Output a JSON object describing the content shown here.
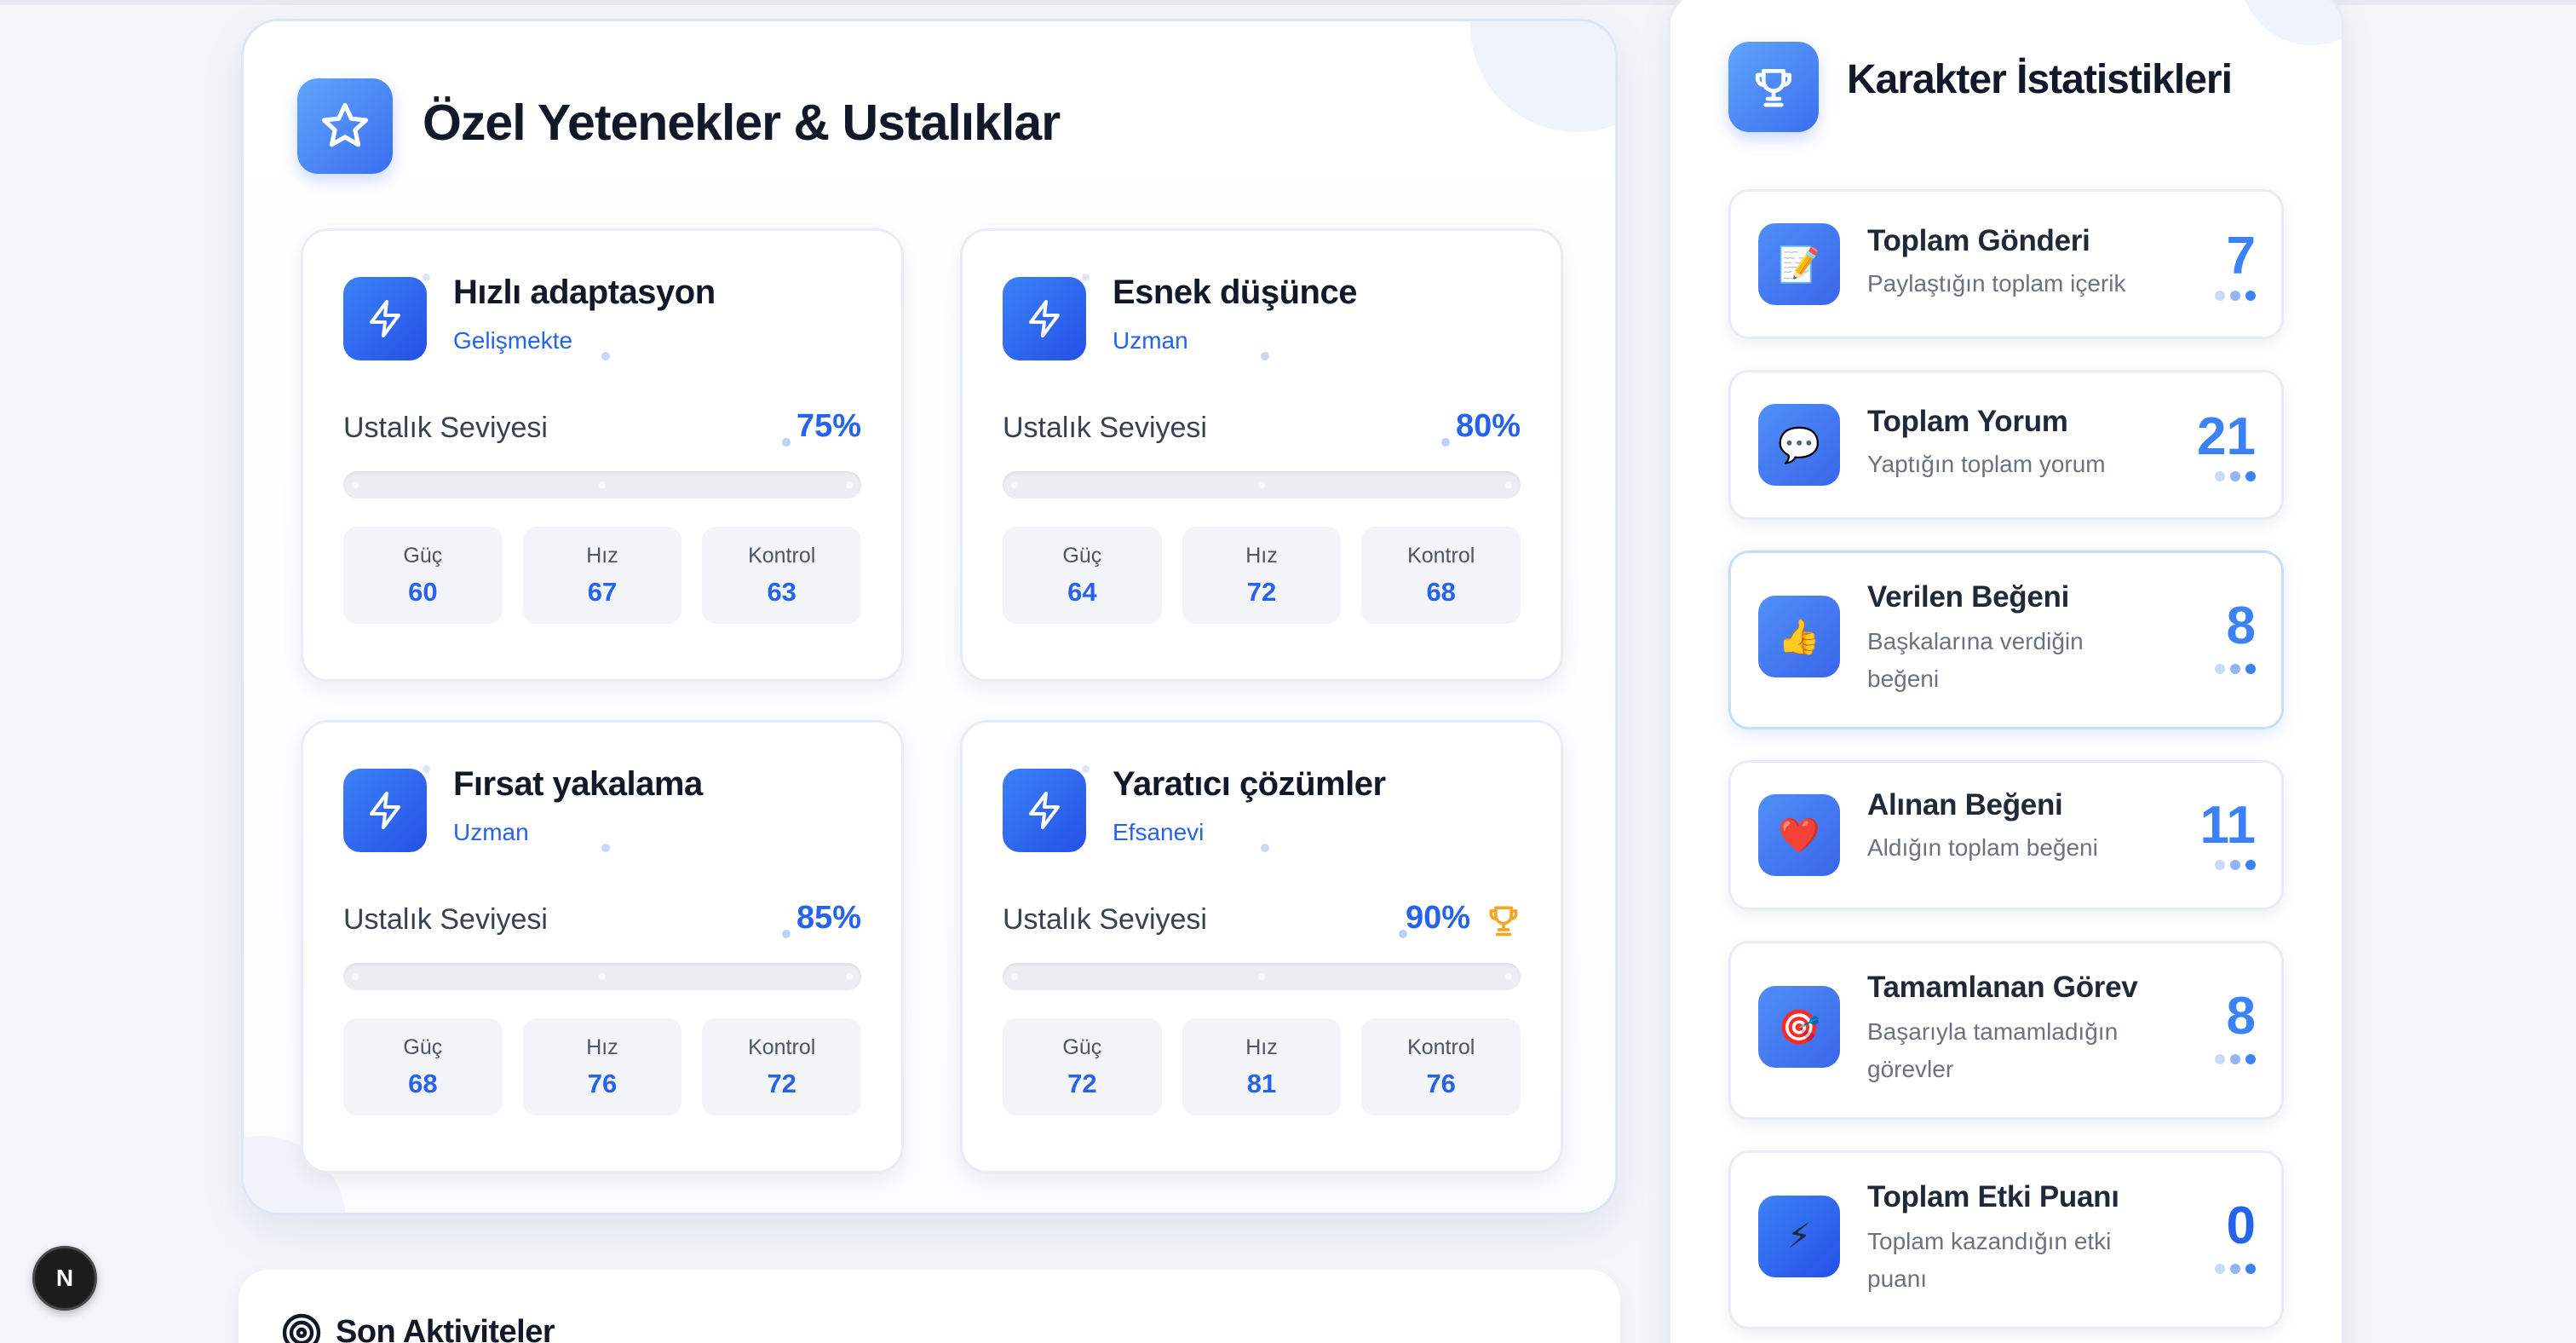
{
  "skills_panel": {
    "title": "Özel Yetenekler & Ustalıklar",
    "mastery_label": "Ustalık Seviyesi",
    "stat_labels": {
      "power": "Güç",
      "speed": "Hız",
      "control": "Kontrol"
    },
    "skills": [
      {
        "name": "Hızlı adaptasyon",
        "level": "Gelişmekte",
        "mastery": "75%",
        "power": "60",
        "speed": "67",
        "control": "63"
      },
      {
        "name": "Esnek düşünce",
        "level": "Uzman",
        "mastery": "80%",
        "power": "64",
        "speed": "72",
        "control": "68"
      },
      {
        "name": "Fırsat yakalama",
        "level": "Uzman",
        "mastery": "85%",
        "power": "68",
        "speed": "76",
        "control": "72"
      },
      {
        "name": "Yaratıcı çözümler",
        "level": "Efsanevi",
        "mastery": "90%",
        "power": "72",
        "speed": "81",
        "control": "76"
      }
    ]
  },
  "activities": {
    "title": "Son Aktiviteler"
  },
  "stats_panel": {
    "title": "Karakter İstatistikleri",
    "items": [
      {
        "title": "Toplam Gönderi",
        "desc": "Paylaştığın toplam içerik",
        "value": "7",
        "icon": "memo-icon",
        "glyph": "📝"
      },
      {
        "title": "Toplam Yorum",
        "desc": "Yaptığın toplam yorum",
        "value": "21",
        "icon": "speech-bubble-icon",
        "glyph": "💬"
      },
      {
        "title": "Verilen Beğeni",
        "desc": "Başkalarına verdiğin beğeni",
        "value": "8",
        "icon": "thumbs-up-icon",
        "glyph": "👍"
      },
      {
        "title": "Alınan Beğeni",
        "desc": "Aldığın toplam beğeni",
        "value": "11",
        "icon": "heart-icon",
        "glyph": "❤️"
      },
      {
        "title": "Tamamlanan Görev",
        "desc": "Başarıyla tamamladığın görevler",
        "value": "8",
        "icon": "target-icon",
        "glyph": "🎯"
      },
      {
        "title": "Toplam Etki Puanı",
        "desc": "Toplam kazandığın etki puanı",
        "value": "0",
        "icon": "lightning-icon",
        "glyph": "⚡"
      }
    ]
  },
  "next_badge": {
    "letter": "N"
  },
  "colors": {
    "accent": "#2563eb",
    "accent_light": "#3b82f6",
    "trophy": "#f5a623"
  }
}
